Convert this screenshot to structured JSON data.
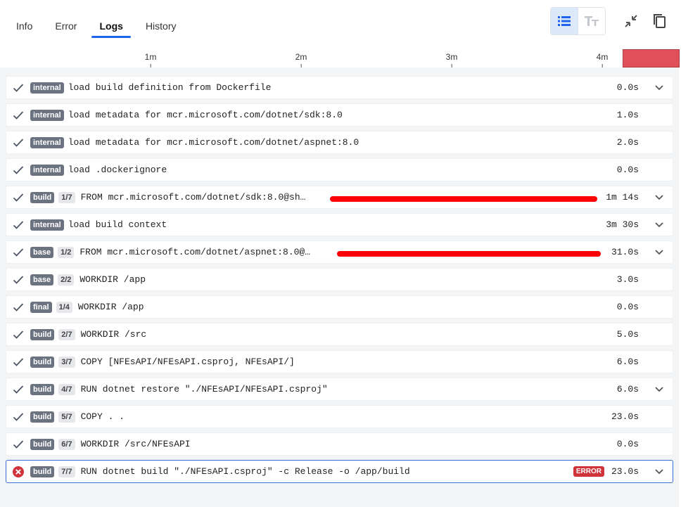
{
  "tabs": [
    {
      "label": "Info",
      "active": false
    },
    {
      "label": "Error",
      "active": false
    },
    {
      "label": "Logs",
      "active": true
    },
    {
      "label": "History",
      "active": false
    }
  ],
  "toolbar": {
    "list_view_icon": "list-icon",
    "text_size_icon": "text-size-icon",
    "collapse_icon": "collapse-icon",
    "copy_icon": "copy-icon"
  },
  "timeline": {
    "ticks": [
      "1m",
      "2m",
      "3m",
      "4m"
    ],
    "marker_color": "#e0505a"
  },
  "colors": {
    "accent": "#1d63ed",
    "success_check": "#4b5563",
    "error": "#d0343a"
  },
  "rows": [
    {
      "status": "done",
      "tag": "internal",
      "step": "",
      "command": "load build definition from Dockerfile",
      "duration": "0.0s",
      "expandable": true
    },
    {
      "status": "done",
      "tag": "internal",
      "step": "",
      "command": "load metadata for mcr.microsoft.com/dotnet/sdk:8.0",
      "duration": "1.0s",
      "expandable": false
    },
    {
      "status": "done",
      "tag": "internal",
      "step": "",
      "command": "load metadata for mcr.microsoft.com/dotnet/aspnet:8.0",
      "duration": "2.0s",
      "expandable": false
    },
    {
      "status": "done",
      "tag": "internal",
      "step": "",
      "command": "load .dockerignore",
      "duration": "0.0s",
      "expandable": false
    },
    {
      "status": "done",
      "tag": "build",
      "step": "1/7",
      "command": "FROM mcr.microsoft.com/dotnet/sdk:8.0@sh…",
      "duration": "1m 14s",
      "expandable": true,
      "redacted": true
    },
    {
      "status": "done",
      "tag": "internal",
      "step": "",
      "command": "load build context",
      "duration": "3m 30s",
      "expandable": true
    },
    {
      "status": "done",
      "tag": "base",
      "step": "1/2",
      "command": "FROM mcr.microsoft.com/dotnet/aspnet:8.0@…",
      "duration": "31.0s",
      "expandable": true,
      "redacted": true
    },
    {
      "status": "done",
      "tag": "base",
      "step": "2/2",
      "command": "WORKDIR /app",
      "duration": "3.0s",
      "expandable": false
    },
    {
      "status": "done",
      "tag": "final",
      "step": "1/4",
      "command": "WORKDIR /app",
      "duration": "0.0s",
      "expandable": false
    },
    {
      "status": "done",
      "tag": "build",
      "step": "2/7",
      "command": "WORKDIR /src",
      "duration": "5.0s",
      "expandable": false
    },
    {
      "status": "done",
      "tag": "build",
      "step": "3/7",
      "command": "COPY [NFEsAPI/NFEsAPI.csproj, NFEsAPI/]",
      "duration": "6.0s",
      "expandable": false
    },
    {
      "status": "done",
      "tag": "build",
      "step": "4/7",
      "command": "RUN dotnet restore \"./NFEsAPI/NFEsAPI.csproj\"",
      "duration": "6.0s",
      "expandable": true
    },
    {
      "status": "done",
      "tag": "build",
      "step": "5/7",
      "command": "COPY . .",
      "duration": "23.0s",
      "expandable": false
    },
    {
      "status": "done",
      "tag": "build",
      "step": "6/7",
      "command": "WORKDIR /src/NFEsAPI",
      "duration": "0.0s",
      "expandable": false
    },
    {
      "status": "error",
      "tag": "build",
      "step": "7/7",
      "command": "RUN dotnet build \"./NFEsAPI.csproj\" -c Release -o /app/build",
      "duration": "23.0s",
      "expandable": true,
      "error_label": "ERROR"
    }
  ]
}
